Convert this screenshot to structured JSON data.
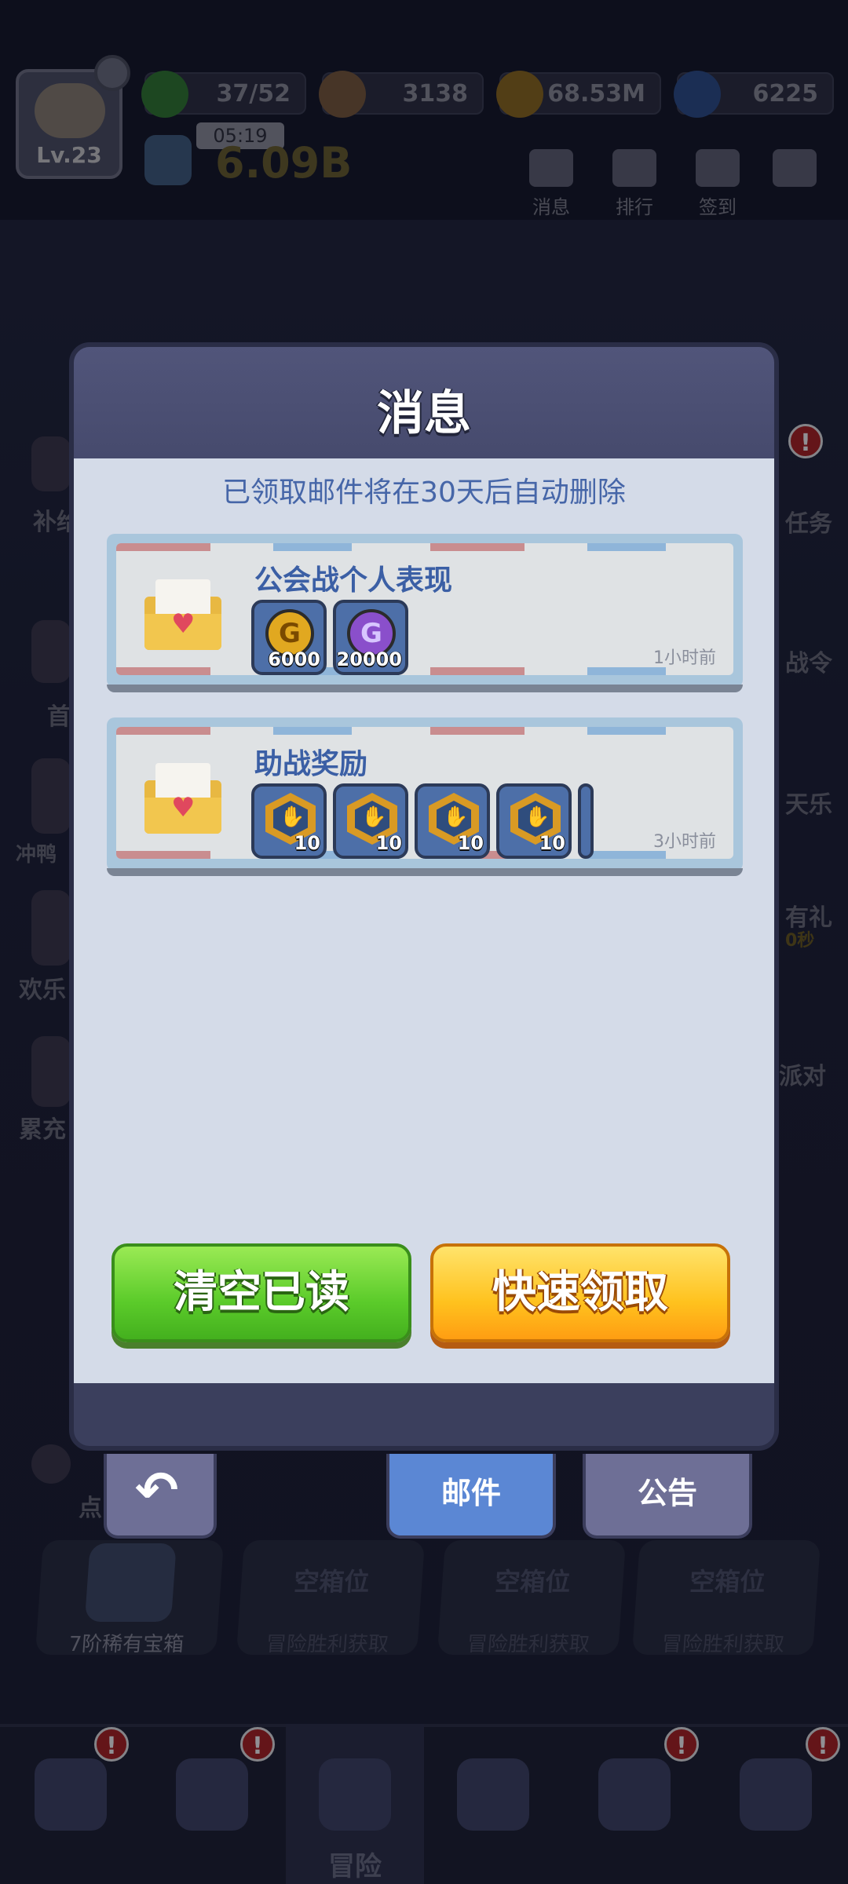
{
  "player": {
    "level": "Lv.23",
    "timer": "05:19",
    "power": "6.09B"
  },
  "resources": [
    {
      "name": "energy",
      "value": "37/52",
      "color": "#3aa83a"
    },
    {
      "name": "exp",
      "value": "3138",
      "color": "#b07a3a"
    },
    {
      "name": "gold",
      "value": "68.53M",
      "color": "#d9a21e"
    },
    {
      "name": "gems",
      "value": "6225",
      "color": "#3a7ad9"
    }
  ],
  "top_icons": [
    {
      "label": "消息",
      "icon": "mail-icon"
    },
    {
      "label": "排行",
      "icon": "ranking-icon"
    },
    {
      "label": "签到",
      "icon": "checkin-icon"
    },
    {
      "label": "",
      "icon": "share-icon"
    }
  ],
  "side_left": [
    "补给",
    "首",
    "冲鸭",
    "欢乐",
    "累充",
    "点"
  ],
  "side_right": [
    "任务",
    "战令",
    "天乐",
    "有礼",
    "派对"
  ],
  "side_right_timer": "0秒",
  "badge": "!",
  "modal": {
    "title": "消息",
    "notice": "已领取邮件将在30天后自动删除",
    "mails": [
      {
        "title": "公会战个人表现",
        "time": "1小时前",
        "items": [
          {
            "icon": "gold-coin-icon",
            "qty": "6000"
          },
          {
            "icon": "purple-coin-icon",
            "qty": "20000"
          }
        ]
      },
      {
        "title": "助战奖励",
        "time": "3小时前",
        "items": [
          {
            "icon": "handshake-medal-icon",
            "qty": "10"
          },
          {
            "icon": "handshake-medal-icon",
            "qty": "10"
          },
          {
            "icon": "handshake-medal-icon",
            "qty": "10"
          },
          {
            "icon": "handshake-medal-icon",
            "qty": "10"
          }
        ]
      }
    ],
    "buttons": {
      "clear_read": "清空已读",
      "quick_claim": "快速领取"
    },
    "tabs": {
      "back": "↶",
      "mail": "邮件",
      "notice": "公告"
    }
  },
  "chest_slots": [
    {
      "title": "",
      "subtitle": "7阶稀有宝箱"
    },
    {
      "title": "空箱位",
      "subtitle": "冒险胜利获取"
    },
    {
      "title": "空箱位",
      "subtitle": "冒险胜利获取"
    },
    {
      "title": "空箱位",
      "subtitle": "冒险胜利获取"
    }
  ],
  "bottom_nav": [
    {
      "icon": "shop-tv-icon",
      "label": ""
    },
    {
      "icon": "keyhole-icon",
      "label": ""
    },
    {
      "icon": "map-icon",
      "label": "冒险"
    },
    {
      "icon": "guild-shield-icon",
      "label": ""
    },
    {
      "icon": "target-icon",
      "label": ""
    },
    {
      "icon": "scroll-icon",
      "label": ""
    }
  ]
}
